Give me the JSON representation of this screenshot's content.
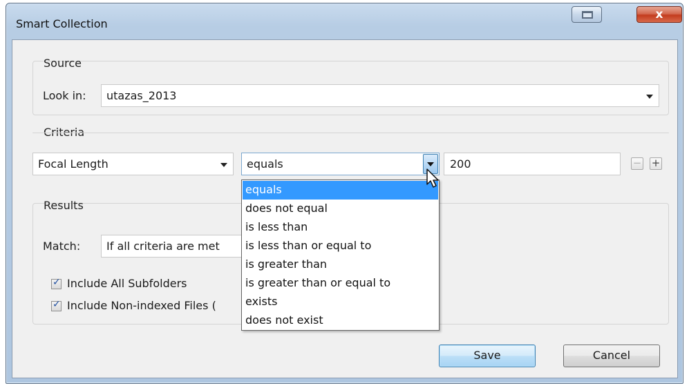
{
  "window": {
    "title": "Smart Collection",
    "close_label": "x"
  },
  "source": {
    "group_label": "Source",
    "look_in_label": "Look in:",
    "look_in_value": "utazas_2013"
  },
  "criteria": {
    "group_label": "Criteria",
    "field_value": "Focal Length",
    "operator_value": "equals",
    "value": "200",
    "remove_label": "−",
    "add_label": "+",
    "operator_options": [
      "equals",
      "does not equal",
      "is less than",
      "is less than or equal to",
      "is greater than",
      "is greater than or equal to",
      "exists",
      "does not exist"
    ],
    "selected_option_index": 0
  },
  "results": {
    "group_label": "Results",
    "match_label": "Match:",
    "match_value": "If all criteria are met",
    "include_subfolders_label": "Include All Subfolders",
    "include_subfolders_checked": true,
    "include_nonindexed_label": "Include Non-indexed Files (",
    "include_nonindexed_checked": true
  },
  "buttons": {
    "save_label": "Save",
    "cancel_label": "Cancel"
  },
  "colors": {
    "highlight": "#3399ff",
    "close_button": "#c33c1e",
    "default_button_border": "#3c7fb1"
  }
}
